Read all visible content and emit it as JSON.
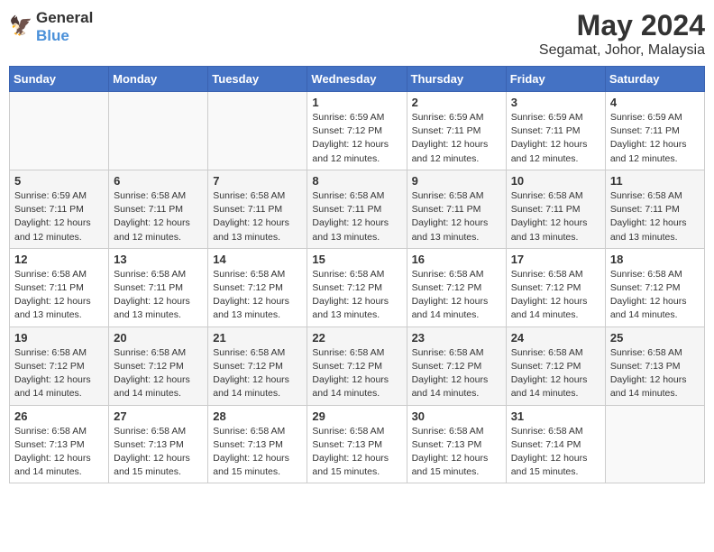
{
  "header": {
    "logo_line1": "General",
    "logo_line2": "Blue",
    "month_year": "May 2024",
    "location": "Segamat, Johor, Malaysia"
  },
  "weekdays": [
    "Sunday",
    "Monday",
    "Tuesday",
    "Wednesday",
    "Thursday",
    "Friday",
    "Saturday"
  ],
  "weeks": [
    [
      {
        "day": "",
        "info": ""
      },
      {
        "day": "",
        "info": ""
      },
      {
        "day": "",
        "info": ""
      },
      {
        "day": "1",
        "info": "Sunrise: 6:59 AM\nSunset: 7:12 PM\nDaylight: 12 hours\nand 12 minutes."
      },
      {
        "day": "2",
        "info": "Sunrise: 6:59 AM\nSunset: 7:11 PM\nDaylight: 12 hours\nand 12 minutes."
      },
      {
        "day": "3",
        "info": "Sunrise: 6:59 AM\nSunset: 7:11 PM\nDaylight: 12 hours\nand 12 minutes."
      },
      {
        "day": "4",
        "info": "Sunrise: 6:59 AM\nSunset: 7:11 PM\nDaylight: 12 hours\nand 12 minutes."
      }
    ],
    [
      {
        "day": "5",
        "info": "Sunrise: 6:59 AM\nSunset: 7:11 PM\nDaylight: 12 hours\nand 12 minutes."
      },
      {
        "day": "6",
        "info": "Sunrise: 6:58 AM\nSunset: 7:11 PM\nDaylight: 12 hours\nand 12 minutes."
      },
      {
        "day": "7",
        "info": "Sunrise: 6:58 AM\nSunset: 7:11 PM\nDaylight: 12 hours\nand 13 minutes."
      },
      {
        "day": "8",
        "info": "Sunrise: 6:58 AM\nSunset: 7:11 PM\nDaylight: 12 hours\nand 13 minutes."
      },
      {
        "day": "9",
        "info": "Sunrise: 6:58 AM\nSunset: 7:11 PM\nDaylight: 12 hours\nand 13 minutes."
      },
      {
        "day": "10",
        "info": "Sunrise: 6:58 AM\nSunset: 7:11 PM\nDaylight: 12 hours\nand 13 minutes."
      },
      {
        "day": "11",
        "info": "Sunrise: 6:58 AM\nSunset: 7:11 PM\nDaylight: 12 hours\nand 13 minutes."
      }
    ],
    [
      {
        "day": "12",
        "info": "Sunrise: 6:58 AM\nSunset: 7:11 PM\nDaylight: 12 hours\nand 13 minutes."
      },
      {
        "day": "13",
        "info": "Sunrise: 6:58 AM\nSunset: 7:11 PM\nDaylight: 12 hours\nand 13 minutes."
      },
      {
        "day": "14",
        "info": "Sunrise: 6:58 AM\nSunset: 7:12 PM\nDaylight: 12 hours\nand 13 minutes."
      },
      {
        "day": "15",
        "info": "Sunrise: 6:58 AM\nSunset: 7:12 PM\nDaylight: 12 hours\nand 13 minutes."
      },
      {
        "day": "16",
        "info": "Sunrise: 6:58 AM\nSunset: 7:12 PM\nDaylight: 12 hours\nand 14 minutes."
      },
      {
        "day": "17",
        "info": "Sunrise: 6:58 AM\nSunset: 7:12 PM\nDaylight: 12 hours\nand 14 minutes."
      },
      {
        "day": "18",
        "info": "Sunrise: 6:58 AM\nSunset: 7:12 PM\nDaylight: 12 hours\nand 14 minutes."
      }
    ],
    [
      {
        "day": "19",
        "info": "Sunrise: 6:58 AM\nSunset: 7:12 PM\nDaylight: 12 hours\nand 14 minutes."
      },
      {
        "day": "20",
        "info": "Sunrise: 6:58 AM\nSunset: 7:12 PM\nDaylight: 12 hours\nand 14 minutes."
      },
      {
        "day": "21",
        "info": "Sunrise: 6:58 AM\nSunset: 7:12 PM\nDaylight: 12 hours\nand 14 minutes."
      },
      {
        "day": "22",
        "info": "Sunrise: 6:58 AM\nSunset: 7:12 PM\nDaylight: 12 hours\nand 14 minutes."
      },
      {
        "day": "23",
        "info": "Sunrise: 6:58 AM\nSunset: 7:12 PM\nDaylight: 12 hours\nand 14 minutes."
      },
      {
        "day": "24",
        "info": "Sunrise: 6:58 AM\nSunset: 7:12 PM\nDaylight: 12 hours\nand 14 minutes."
      },
      {
        "day": "25",
        "info": "Sunrise: 6:58 AM\nSunset: 7:13 PM\nDaylight: 12 hours\nand 14 minutes."
      }
    ],
    [
      {
        "day": "26",
        "info": "Sunrise: 6:58 AM\nSunset: 7:13 PM\nDaylight: 12 hours\nand 14 minutes."
      },
      {
        "day": "27",
        "info": "Sunrise: 6:58 AM\nSunset: 7:13 PM\nDaylight: 12 hours\nand 15 minutes."
      },
      {
        "day": "28",
        "info": "Sunrise: 6:58 AM\nSunset: 7:13 PM\nDaylight: 12 hours\nand 15 minutes."
      },
      {
        "day": "29",
        "info": "Sunrise: 6:58 AM\nSunset: 7:13 PM\nDaylight: 12 hours\nand 15 minutes."
      },
      {
        "day": "30",
        "info": "Sunrise: 6:58 AM\nSunset: 7:13 PM\nDaylight: 12 hours\nand 15 minutes."
      },
      {
        "day": "31",
        "info": "Sunrise: 6:58 AM\nSunset: 7:14 PM\nDaylight: 12 hours\nand 15 minutes."
      },
      {
        "day": "",
        "info": ""
      }
    ]
  ]
}
